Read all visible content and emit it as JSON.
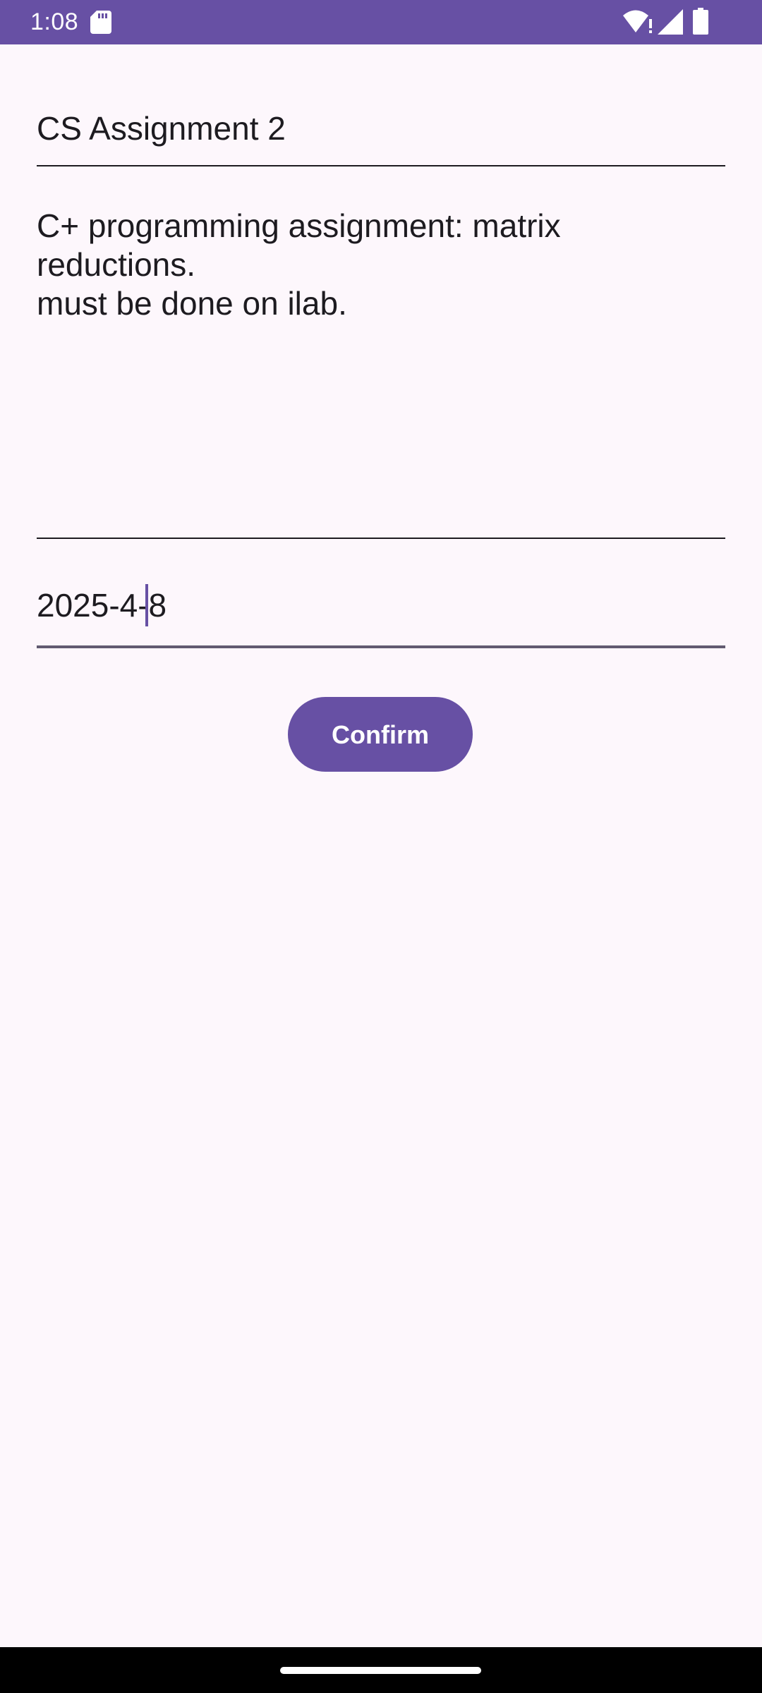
{
  "status_bar": {
    "time": "1:08",
    "icons": [
      "sd-card-icon",
      "wifi-icon",
      "cell-signal-icon",
      "battery-icon"
    ],
    "background": "#6750A4"
  },
  "form": {
    "title_value": "CS Assignment 2",
    "description_lines": [
      "C+ programming assignment: matrix",
      "reductions.",
      "must be done on ilab."
    ],
    "date_value": "2025-4-8",
    "confirm_label": "Confirm"
  },
  "colors": {
    "accent": "#6750A4",
    "background": "#FDF7FC",
    "text": "#1D1B20"
  }
}
